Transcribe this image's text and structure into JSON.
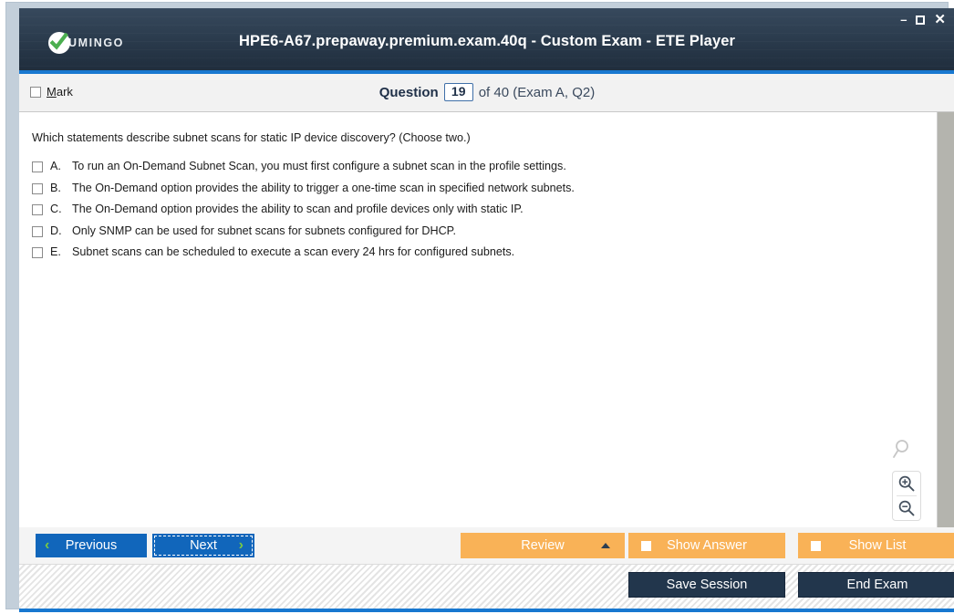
{
  "window": {
    "title": "HPE6-A67.prepaway.premium.exam.40q - Custom Exam - ETE Player",
    "logo_text": "UMINGO",
    "controls": {
      "minimize": "–",
      "maximize": "",
      "close": "✕"
    },
    "colors": {
      "titlebar_dark": "#2d3e50",
      "accent_blue": "#1878d0",
      "button_blue": "#1166bb",
      "button_orange": "#f9b257",
      "button_navy": "#22364c",
      "chevron_green": "#7ac943"
    }
  },
  "header": {
    "mark_label_underlined": "M",
    "mark_label_rest": "ark",
    "question_word": "Question",
    "question_number": "19",
    "of_text": "of 40 (Exam A, Q2)"
  },
  "question": {
    "text": "Which statements describe subnet scans for static IP device discovery? (Choose two.)",
    "options": [
      {
        "letter": "A.",
        "text": "To run an On-Demand Subnet Scan, you must first configure a subnet scan in the profile settings.",
        "checked": false
      },
      {
        "letter": "B.",
        "text": "The On-Demand option provides the ability to trigger a one-time scan in specified network subnets.",
        "checked": false
      },
      {
        "letter": "C.",
        "text": "The On-Demand option provides the ability to scan and profile devices only with static IP.",
        "checked": false
      },
      {
        "letter": "D.",
        "text": "Only SNMP can be used for subnet scans for subnets configured for DHCP.",
        "checked": false
      },
      {
        "letter": "E.",
        "text": "Subnet scans can be scheduled to execute a scan every 24 hrs for configured subnets.",
        "checked": false
      }
    ]
  },
  "zoom_tools": {
    "magnifier": "magnifier-icon",
    "zoom_in": "zoom-in-icon",
    "zoom_out": "zoom-out-icon"
  },
  "toolbar": {
    "previous": "Previous",
    "next": "Next",
    "review": "Review",
    "show_answer": "Show Answer",
    "show_list": "Show List",
    "save_session": "Save Session",
    "end_exam": "End Exam",
    "prev_chevron": "‹",
    "next_chevron": "›"
  }
}
